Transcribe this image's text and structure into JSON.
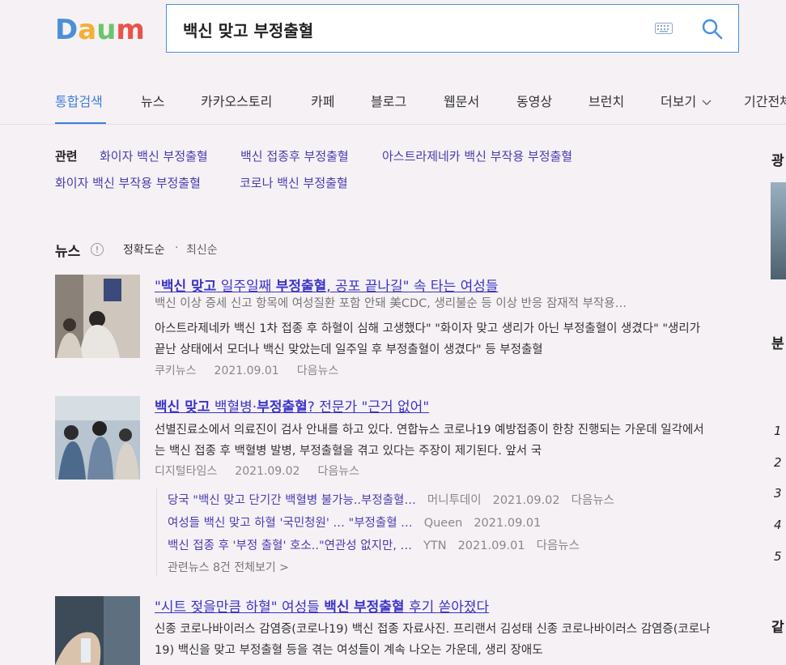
{
  "header": {
    "logo_text": "Daum",
    "search": {
      "value": "백신 맞고 부정출혈"
    }
  },
  "tabs": [
    {
      "label": "통합검색"
    },
    {
      "label": "뉴스"
    },
    {
      "label": "카카오스토리"
    },
    {
      "label": "카페"
    },
    {
      "label": "블로그"
    },
    {
      "label": "웹문서"
    },
    {
      "label": "동영상"
    },
    {
      "label": "브런치"
    },
    {
      "label": "더보기"
    },
    {
      "label": "기간전체"
    }
  ],
  "related": {
    "label": "관련",
    "links": [
      "화이자 백신 부정출혈",
      "백신 접종후 부정출혈",
      "아스트라제네카 백신 부작용 부정출혈",
      "화이자 백신 부작용 부정출혈",
      "코로나 백신 부정출혈"
    ]
  },
  "news": {
    "heading": "뉴스",
    "info": "!",
    "sort_accuracy": "정확도순",
    "sort_sep": "·",
    "sort_recent": "최신순",
    "items": [
      {
        "title_pre": "\"",
        "title_b1": "백신 맞고",
        "title_mid": " 일주일째 ",
        "title_b2": "부정출혈",
        "title_post": ", 공포 끝나길\" 속 타는 여성들",
        "line1": "백신 이상 증세 신고 항목에 여성질환 포함 안돼 美CDC, 생리불순 등 이상 반응 잠재적 부작용…",
        "line2": "아스트라제네카 백신 1차 접종 후 하혈이 심해 고생했다\" \"화이자 맞고 생리가 아닌 부정출혈이 생겼다\" \"생리가 끝난 상태에서 모더나 백신 맞았는데 일주일 후 부정출혈이 생겼다\" 등 부정출혈",
        "source": "쿠키뉴스",
        "date": "2021.09.01",
        "via": "다음뉴스"
      },
      {
        "title_pre": "",
        "title_b1": "백신 맞고",
        "title_mid": " 백혈병·",
        "title_b2": "부정출혈",
        "title_post": "? 전문가 \"근거 없어\"",
        "line1": "선별진료소에서 의료진이 검사 안내를 하고 있다. 연합뉴스 코로나19 예방접종이 한창 진행되는 가운데 일각에서는 백신 접종 후 백혈병 발병, 부정출혈을 겪고 있다는 주장이 제기된다. 앞서 국",
        "source": "디지털타임스",
        "date": "2021.09.02",
        "via": "다음뉴스",
        "sub": [
          {
            "title": "당국 \"백신 맞고 단기간 백혈병 불가능..부정출혈…",
            "source": "머니투데이",
            "date": "2021.09.02",
            "via": "다음뉴스"
          },
          {
            "title": "여성들 백신 맞고 하혈 '국민청원' … \"부정출혈 …",
            "source": "Queen",
            "date": "2021.09.01",
            "via": ""
          },
          {
            "title": "백신 접종 후 '부정 출혈' 호소..\"연관성 없지만, …",
            "source": "YTN",
            "date": "2021.09.01",
            "via": "다음뉴스"
          }
        ],
        "more": "관련뉴스 8건 전체보기 >"
      },
      {
        "title_pre": "\"시트 젖을만큼 하혈\" 여성들 ",
        "title_b1": "백신",
        "title_mid": " ",
        "title_b2": "부정출혈",
        "title_post": " 후기 쏟아졌다",
        "line1": "신종 코로나바이러스 감염증(코로나19) 백신 접종 자료사진. 프리랜서 김성태 신종 코로나바이러스 감염증(코로나19) 백신을 맞고 부정출혈 등을 겪는 여성들이 계속 나오는 가운데, 생리 장애도"
      }
    ]
  },
  "sidebar": {
    "char1": "광",
    "char2": "분",
    "char3": "같",
    "ranks": [
      "1",
      "2",
      "3",
      "4",
      "5"
    ]
  },
  "colors": {
    "accent": "#3c7fd8",
    "link": "#3a35c8",
    "search_border": "#4a90e2"
  }
}
